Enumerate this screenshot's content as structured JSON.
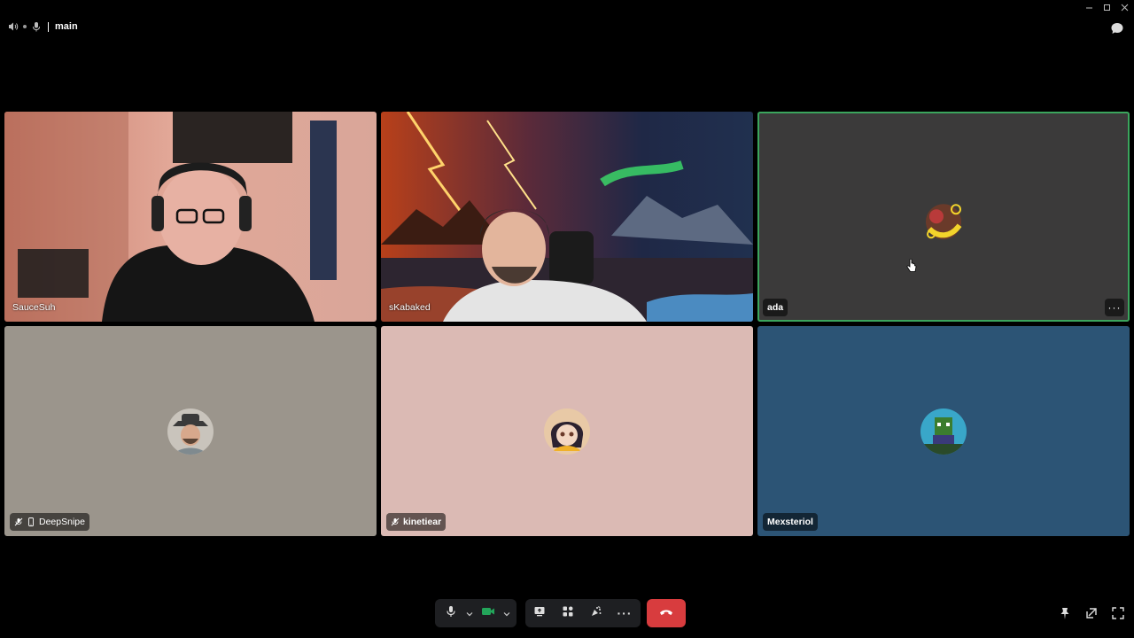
{
  "window": {
    "controls": [
      "minimize-icon",
      "maximize-icon",
      "close-icon"
    ]
  },
  "channel": {
    "name": "main",
    "icons": [
      "speaker-icon",
      "mic-icon"
    ]
  },
  "participants": [
    {
      "name": "SauceSuh",
      "type": "video",
      "speaking": false,
      "muted": false
    },
    {
      "name": "sKabaked",
      "type": "video",
      "speaking": false,
      "muted": false
    },
    {
      "name": "ada",
      "type": "avatar",
      "speaking": true,
      "muted": false,
      "bg": "#3b3a3a",
      "has_more": true,
      "more_label": "···"
    },
    {
      "name": "DeepSnipe",
      "type": "avatar",
      "speaking": false,
      "muted": true,
      "mobile": true,
      "bg": "#9b958c"
    },
    {
      "name": "kinetiear",
      "type": "avatar",
      "speaking": false,
      "muted": true,
      "bg": "#dbbab4"
    },
    {
      "name": "Mexsteriol",
      "type": "avatar",
      "speaking": false,
      "muted": false,
      "bg": "#2c5475"
    }
  ],
  "controls": {
    "group1": [
      "microphone-icon",
      "chevron-down-icon",
      "camera-icon",
      "chevron-down-icon"
    ],
    "group2": [
      "share-screen-icon",
      "activities-icon",
      "soundboard-icon",
      "more-icon"
    ],
    "more_label": "···",
    "hangup": "hangup-icon"
  },
  "colors": {
    "speaking_border": "#3ba55d",
    "hangup_red": "#d83c3e",
    "camera_green": "#23a55a"
  },
  "bottom_right": [
    "pin-icon",
    "popout-icon",
    "fullscreen-icon"
  ]
}
